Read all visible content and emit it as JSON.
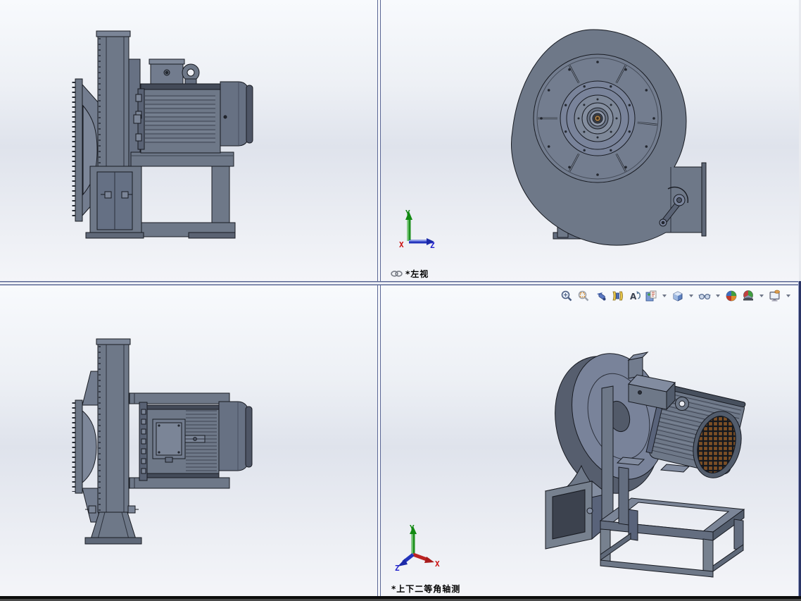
{
  "viewports": {
    "top_left": {
      "content": "side elevation of centrifugal fan blower with motor on base frame"
    },
    "top_right": {
      "label": "*左视",
      "content": "front view of fan volute with hub, ribs and outlet damper"
    },
    "bottom_left": {
      "content": "plan (top) view of centrifugal fan blower with motor"
    },
    "bottom_right": {
      "label": "*上下二等角轴测",
      "content": "isometric view of complete fan and motor assembly"
    }
  },
  "triad": {
    "x": "X",
    "y": "Y",
    "z": "Z"
  },
  "triad_colors": {
    "x": "#cc1111",
    "y": "#118811",
    "z": "#2222cc"
  },
  "toolbar": {
    "items": [
      {
        "name": "zoom-to-fit"
      },
      {
        "name": "zoom-to-area"
      },
      {
        "name": "previous-view"
      },
      {
        "name": "section-view"
      },
      {
        "name": "dynamic-annotation-views"
      },
      {
        "name": "view-orientation",
        "dropdown": true
      },
      {
        "name": "display-style",
        "dropdown": true
      },
      {
        "name": "hide-show-items",
        "dropdown": true
      },
      {
        "name": "edit-appearance"
      },
      {
        "name": "apply-scene",
        "dropdown": true
      },
      {
        "name": "view-settings",
        "dropdown": true
      }
    ]
  },
  "colors": {
    "model_body": "#6e7888",
    "model_light": "#8590a2",
    "model_dark": "#4e5565",
    "model_outline": "#181b22",
    "shaft_center": "#9a7342",
    "divider": "#5a6694",
    "background_band": "#dfe3ec"
  }
}
